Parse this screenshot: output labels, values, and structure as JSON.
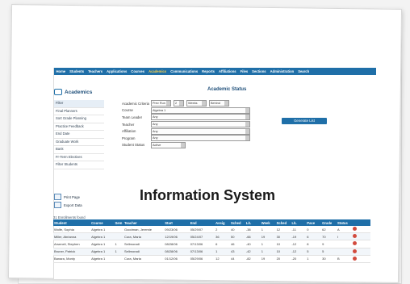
{
  "nav": [
    "Home",
    "Students",
    "Teachers",
    "Applications",
    "Courses",
    "Academics",
    "Communications",
    "Reports",
    "Affiliations",
    "Files",
    "Sections",
    "Administration",
    "Search"
  ],
  "nav_active": "Academics",
  "sidebar": {
    "title": "Academics",
    "items": [
      "Filter",
      "Final Planners",
      "Sort Grade Planning",
      "Practice Feedback",
      "End Date",
      "Graduate Work",
      "Bank",
      "Fr-Term Electives",
      "Filter Students"
    ],
    "actions": [
      "Print Page",
      "Export Data"
    ]
  },
  "form": {
    "title": "Academic Status",
    "rows": [
      {
        "label": "Academic Criteria",
        "values": [
          "Prev Run",
          "2",
          "Weeks",
          "Behind"
        ]
      },
      {
        "label": "Course",
        "values": [
          "Algebra 1"
        ]
      },
      {
        "label": "Team Leader",
        "values": [
          "Any"
        ]
      },
      {
        "label": "Teacher",
        "values": [
          "Any"
        ]
      },
      {
        "label": "Affiliation",
        "values": [
          "Any"
        ]
      },
      {
        "label": "Program",
        "values": [
          "Any"
        ]
      },
      {
        "label": "Student Status",
        "values": [
          "Active"
        ]
      }
    ],
    "generate_label": "Generate List"
  },
  "caption": "Information System",
  "table": {
    "title": "31 Enrollments found",
    "headers": [
      "Student",
      "Course",
      "Sem",
      "Teacher",
      "Start",
      "End",
      "Assig",
      "Sched",
      "L/L",
      "Week",
      "Sched",
      "L/L",
      "Pace",
      "Grade",
      "Status"
    ],
    "rows": [
      [
        "Wolfe, Sophia",
        "Algebra 1",
        "",
        "Goodman, Jeremie",
        "09/23/06",
        "05/29/07",
        "2",
        "40",
        "-38",
        "1",
        "12",
        "-11",
        "0",
        "62",
        "A"
      ],
      [
        "Miller, Abrianna",
        "Algebra 1",
        "",
        "Cura, Maria",
        "12/19/06",
        "05/24/07",
        "36",
        "50",
        "-66",
        "19",
        "30",
        "-19",
        "6",
        "70",
        "I"
      ],
      [
        "Arseneli, Stephen",
        "Algebra 1",
        "1",
        "Sellmoradi",
        "08/28/06",
        "07/13/06",
        "6",
        "46",
        "-40",
        "1",
        "10",
        "-12",
        "8",
        "9",
        ""
      ],
      [
        "Bruner, Patrick",
        "Algebra 1",
        "1",
        "Sellmoradi",
        "08/28/06",
        "07/13/06",
        "1",
        "43",
        "-42",
        "1",
        "10",
        "-12",
        "5",
        "5",
        ""
      ],
      [
        "Banara, Monty",
        "Algebra 1",
        "",
        "Cura, Maria",
        "01/12/06",
        "05/29/06",
        "12",
        "44",
        "-82",
        "19",
        "20",
        "-20",
        "1",
        "30",
        "B"
      ]
    ]
  },
  "colors": {
    "nav_bg": "#1f6fa8",
    "accent": "#1f4f7a",
    "delete": "#d24b3e"
  }
}
